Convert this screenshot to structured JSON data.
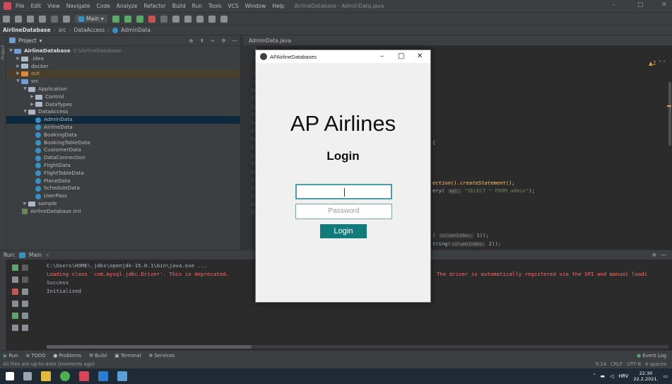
{
  "window": {
    "menu": [
      "File",
      "Edit",
      "View",
      "Navigate",
      "Code",
      "Analyze",
      "Refactor",
      "Build",
      "Run",
      "Tools",
      "VCS",
      "Window",
      "Help"
    ],
    "title": "AirlineDatabase - AdminData.java",
    "minimize": "–",
    "maximize": "□",
    "close": "✕"
  },
  "toolbar": {
    "run_config": "Main"
  },
  "breadcrumb": {
    "project": "AirlineDatabase",
    "src": "src",
    "pkg": "DataAccess",
    "cls": "AdminData"
  },
  "project_panel": {
    "header": "Project",
    "root": "AirlineDatabase",
    "root_path": "C:\\AirlineDatabase",
    "items": {
      "idea": ".idea",
      "docker": "docker",
      "out": "out",
      "src": "src",
      "application": "Application",
      "control": "Control",
      "datatypes": "DataTypes",
      "dataaccess": "DataAccess",
      "admindata": "AdminData",
      "airlinedata": "AirlineData",
      "bookingdata": "BookingData",
      "bookingtabledata": "BookingTableData",
      "customerdata": "CustomerData",
      "dataconnection": "DataConnection",
      "flightdata": "FlightData",
      "flighttabledata": "FlightTableData",
      "planedata": "PlaneData",
      "scheduledata": "ScheduleData",
      "userpass": "UserPass",
      "sample": "sample",
      "iml": "AirlineDatabase.iml"
    }
  },
  "editor": {
    "tab": "AdminData.java",
    "line_numbers": [
      "5",
      "6",
      "7",
      "8",
      "9",
      "10",
      "11",
      "12",
      "13",
      "14",
      "15",
      "16",
      "17",
      "18",
      "19",
      "20",
      "21",
      "22",
      "23",
      "24",
      "25"
    ],
    "warnings": "▲2",
    "code_brace": "{",
    "code_stmt": "ection().createStatement();",
    "code_query_pre": "ery(",
    "code_query_hint": "sql:",
    "code_query_str": "\"SELECT * FROM admin\"",
    "code_query_post": ");",
    "code_getint_pre": "(",
    "code_getint_hint": "columnIndex:",
    "code_getint_post": "1));",
    "code_getstr_pre": "tring(",
    "code_getstr_hint": "columnIndex:",
    "code_getstr_post": "2));"
  },
  "run_panel": {
    "label": "Run:",
    "tab": "Main",
    "lines": {
      "cmd": "C:\\Users\\HOME\\.jdks\\openjdk-15.0.1\\bin\\java.exe ...",
      "warn_left": "Loading class `com.mysql.jdbc.Driver'. This is deprecated.",
      "warn_right": "The driver is automatically registered via the SPI and manual loadi",
      "success": "Success",
      "init": "Initialized"
    }
  },
  "tool_tabs": [
    "Run",
    "TODO",
    "Problems",
    "Build",
    "Terminal",
    "Services"
  ],
  "event_log": "Event Log",
  "status": {
    "message": "All files are up-to-date (moments ago)",
    "position": "9:14",
    "line_sep": "CRLF",
    "encoding": "UTF-8",
    "indent": "4 spaces"
  },
  "taskbar": {
    "lang": "HRV",
    "time": "22:30",
    "date": "22.2.2021."
  },
  "dialog": {
    "title": "APAirlineDatabases",
    "heading": "AP Airlines",
    "subheading": "Login",
    "username_value": "",
    "password_placeholder": "Password",
    "login_button": "Login"
  },
  "colors": {
    "accent": "#0f7b7b",
    "ide_bg": "#2b2b2b",
    "panel_bg": "#3c3f41",
    "error_text": "#ff6b68"
  }
}
